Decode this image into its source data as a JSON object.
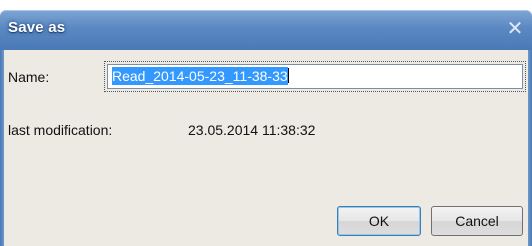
{
  "dialog": {
    "title": "Save as",
    "close_glyph": "✕"
  },
  "form": {
    "name_label": "Name:",
    "name_value": "Read_2014-05-23_11-38-33",
    "last_modification_label": "last modification:",
    "last_modification_value": "23.05.2014 11:38:32"
  },
  "buttons": {
    "ok_label": "OK",
    "cancel_label": "Cancel"
  },
  "colors": {
    "titlebar": "#5b88c2",
    "client_bg": "#ede9e3",
    "selection": "#3399ff"
  }
}
